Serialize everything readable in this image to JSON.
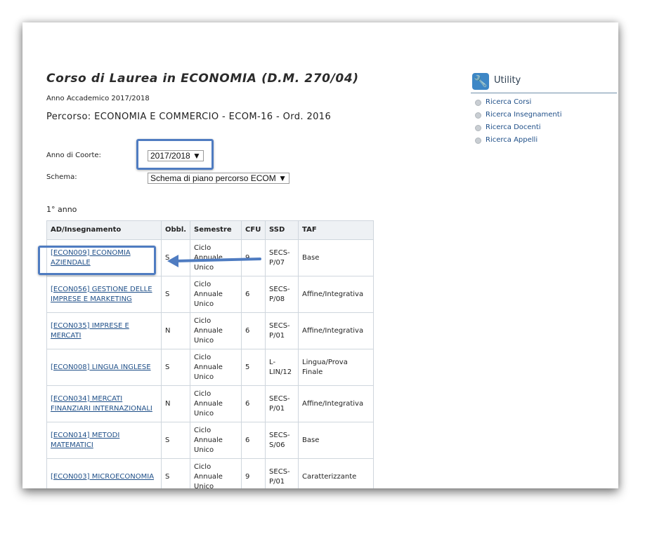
{
  "header": {
    "title": "Corso di Laurea in ECONOMIA (D.M. 270/04)",
    "academic_year": "Anno Accademico 2017/2018",
    "percorso": "Percorso: ECONOMIA E COMMERCIO - ECOM-16 - Ord. 2016"
  },
  "filters": {
    "coorte_label": "Anno di Coorte:",
    "coorte_value": "2017/2018 ▼",
    "schema_label": "Schema:",
    "schema_value": "Schema di piano percorso ECOM ▼"
  },
  "section": {
    "year_label": "1° anno"
  },
  "table": {
    "headers": [
      "AD/Insegnamento",
      "Obbl.",
      "Semestre",
      "CFU",
      "SSD",
      "TAF"
    ],
    "rows": [
      {
        "course": "[ECON009] ECONOMIA AZIENDALE",
        "obbl": "S",
        "semestre": "Ciclo Annuale Unico",
        "cfu": "9",
        "ssd": "SECS-P/07",
        "taf": "Base"
      },
      {
        "course": "[ECON056] GESTIONE DELLE IMPRESE E MARKETING",
        "obbl": "S",
        "semestre": "Ciclo Annuale Unico",
        "cfu": "6",
        "ssd": "SECS-P/08",
        "taf": "Affine/Integrativa"
      },
      {
        "course": "[ECON035] IMPRESE E MERCATI",
        "obbl": "N",
        "semestre": "Ciclo Annuale Unico",
        "cfu": "6",
        "ssd": "SECS-P/01",
        "taf": "Affine/Integrativa"
      },
      {
        "course": "[ECON008] LINGUA INGLESE",
        "obbl": "S",
        "semestre": "Ciclo Annuale Unico",
        "cfu": "5",
        "ssd": "L-LIN/12",
        "taf": "Lingua/Prova Finale"
      },
      {
        "course": "[ECON034] MERCATI FINANZIARI INTERNAZIONALI",
        "obbl": "N",
        "semestre": "Ciclo Annuale Unico",
        "cfu": "6",
        "ssd": "SECS-P/01",
        "taf": "Affine/Integrativa"
      },
      {
        "course": "[ECON014] METODI MATEMATICI",
        "obbl": "S",
        "semestre": "Ciclo Annuale Unico",
        "cfu": "6",
        "ssd": "SECS-S/06",
        "taf": "Base"
      },
      {
        "course": "[ECON003] MICROECONOMIA",
        "obbl": "S",
        "semestre": "Ciclo Annuale Unico",
        "cfu": "9",
        "ssd": "SECS-P/01",
        "taf": "Caratterizzante"
      }
    ]
  },
  "utility": {
    "title": "Utility",
    "icon": "wrench-icon",
    "links": [
      "Ricerca Corsi",
      "Ricerca Insegnamenti",
      "Ricerca Docenti",
      "Ricerca Appelli"
    ]
  },
  "colors": {
    "highlight": "#4f7cc1",
    "link": "#1f4f88",
    "header_bg": "#eef1f4"
  }
}
